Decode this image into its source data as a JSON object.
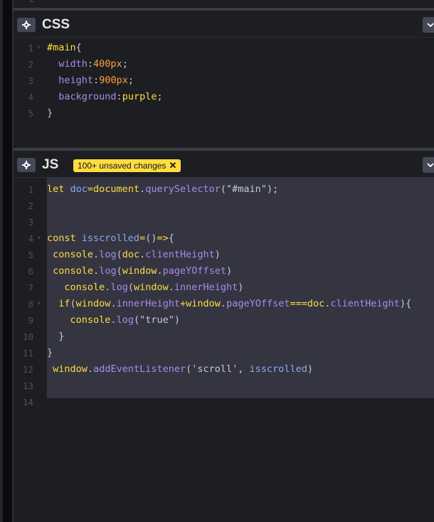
{
  "top_editor": {
    "last_line_number": "2"
  },
  "css_panel": {
    "title": "CSS",
    "line_numbers": [
      "1",
      "2",
      "3",
      "4",
      "5"
    ],
    "lines": [
      [
        [
          "t-sel",
          "#main"
        ],
        [
          "t-punc",
          "{"
        ]
      ],
      [
        [
          "t-punc",
          "  "
        ],
        [
          "t-prop",
          "width"
        ],
        [
          "t-punc",
          ":"
        ],
        [
          "t-num",
          "400px"
        ],
        [
          "t-punc",
          ";"
        ]
      ],
      [
        [
          "t-punc",
          "  "
        ],
        [
          "t-prop",
          "height"
        ],
        [
          "t-punc",
          ":"
        ],
        [
          "t-num",
          "900px"
        ],
        [
          "t-punc",
          ";"
        ]
      ],
      [
        [
          "t-punc",
          "  "
        ],
        [
          "t-prop",
          "background"
        ],
        [
          "t-punc",
          ":"
        ],
        [
          "t-val",
          "purple"
        ],
        [
          "t-punc",
          ";"
        ]
      ],
      [
        [
          "t-punc",
          "}"
        ]
      ]
    ],
    "fold_lines": [
      1
    ]
  },
  "js_panel": {
    "title": "JS",
    "badge": "100+ unsaved changes",
    "badge_close": "✕",
    "line_numbers": [
      "1",
      "2",
      "3",
      "4",
      "5",
      "6",
      "7",
      "8",
      "9",
      "10",
      "11",
      "12",
      "13",
      "14"
    ],
    "lines": [
      [
        [
          "t-kw",
          "let "
        ],
        [
          "t-var",
          "doc"
        ],
        [
          "t-op",
          "="
        ],
        [
          "t-kw",
          "document"
        ],
        [
          "t-punc",
          "."
        ],
        [
          "t-fn",
          "querySelector"
        ],
        [
          "t-punc",
          "("
        ],
        [
          "t-str",
          "\"#main\""
        ],
        [
          "t-punc",
          ");"
        ]
      ],
      [],
      [],
      [
        [
          "t-kw",
          "const "
        ],
        [
          "t-var",
          "isscrolled"
        ],
        [
          "t-op",
          "="
        ],
        [
          "t-punc",
          "()"
        ],
        [
          "t-op",
          "=>"
        ],
        [
          "t-punc",
          "{"
        ]
      ],
      [
        [
          "t-punc",
          " "
        ],
        [
          "t-kw",
          "console"
        ],
        [
          "t-punc",
          "."
        ],
        [
          "t-fn",
          "log"
        ],
        [
          "t-punc",
          "("
        ],
        [
          "t-kw",
          "doc"
        ],
        [
          "t-punc",
          "."
        ],
        [
          "t-fn",
          "clientHeight"
        ],
        [
          "t-punc",
          ")"
        ]
      ],
      [
        [
          "t-punc",
          " "
        ],
        [
          "t-kw",
          "console"
        ],
        [
          "t-punc",
          "."
        ],
        [
          "t-fn",
          "log"
        ],
        [
          "t-punc",
          "("
        ],
        [
          "t-kw",
          "window"
        ],
        [
          "t-punc",
          "."
        ],
        [
          "t-fn",
          "pageYOffset"
        ],
        [
          "t-punc",
          ")"
        ]
      ],
      [
        [
          "t-punc",
          "   "
        ],
        [
          "t-kw",
          "console"
        ],
        [
          "t-punc",
          "."
        ],
        [
          "t-fn",
          "log"
        ],
        [
          "t-punc",
          "("
        ],
        [
          "t-kw",
          "window"
        ],
        [
          "t-punc",
          "."
        ],
        [
          "t-fn",
          "innerHeight"
        ],
        [
          "t-punc",
          ")"
        ]
      ],
      [
        [
          "t-punc",
          "  "
        ],
        [
          "t-kw",
          "if"
        ],
        [
          "t-punc",
          "("
        ],
        [
          "t-kw",
          "window"
        ],
        [
          "t-punc",
          "."
        ],
        [
          "t-fn",
          "innerHeight"
        ],
        [
          "t-op",
          "+"
        ],
        [
          "t-kw",
          "window"
        ],
        [
          "t-punc",
          "."
        ],
        [
          "t-fn",
          "pageYOffset"
        ],
        [
          "t-op",
          "==="
        ],
        [
          "t-kw",
          "doc"
        ],
        [
          "t-punc",
          "."
        ],
        [
          "t-fn",
          "clientHeight"
        ],
        [
          "t-punc",
          "){"
        ]
      ],
      [
        [
          "t-punc",
          "    "
        ],
        [
          "t-kw",
          "console"
        ],
        [
          "t-punc",
          "."
        ],
        [
          "t-fn",
          "log"
        ],
        [
          "t-punc",
          "("
        ],
        [
          "t-str",
          "\"true\""
        ],
        [
          "t-punc",
          ")"
        ]
      ],
      [
        [
          "t-punc",
          "  }"
        ]
      ],
      [
        [
          "t-punc",
          "}"
        ]
      ],
      [
        [
          "t-punc",
          " "
        ],
        [
          "t-kw",
          "window"
        ],
        [
          "t-punc",
          "."
        ],
        [
          "t-fn",
          "addEventListener"
        ],
        [
          "t-punc",
          "("
        ],
        [
          "t-str",
          "'scroll'"
        ],
        [
          "t-punc",
          ", "
        ],
        [
          "t-var",
          "isscrolled"
        ],
        [
          "t-punc",
          ")"
        ]
      ],
      [],
      []
    ],
    "fold_lines": [
      4,
      8
    ]
  },
  "colors": {
    "background": "#1d1e22",
    "badge": "#ffdd40",
    "selection": "#343541"
  }
}
